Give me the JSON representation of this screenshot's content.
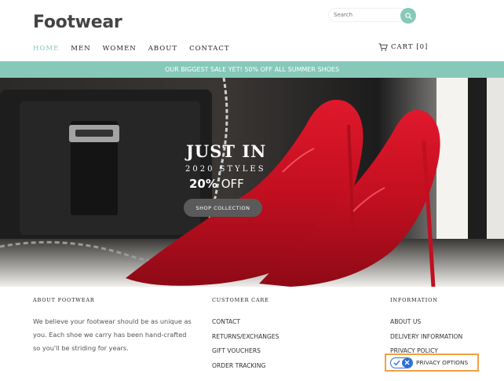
{
  "brand": {
    "name": "Footwear"
  },
  "search": {
    "placeholder": "Search"
  },
  "nav": {
    "items": [
      "HOME",
      "MEN",
      "WOMEN",
      "ABOUT",
      "CONTACT"
    ],
    "active_index": 0
  },
  "cart": {
    "label": "CART [0]"
  },
  "promo_banner": {
    "text": "OUR BIGGEST SALE YET! 50% OFF ALL SUMMER SHOES"
  },
  "hero": {
    "title": "JUST IN",
    "subtitle": "2020 STYLES",
    "offer_bold": "20%",
    "offer_rest": "OFF",
    "button_label": "SHOP COLLECTION"
  },
  "footer": {
    "about": {
      "heading": "ABOUT FOOTWEAR",
      "line1": "We believe your footwear should be as unique as",
      "line2": "you. Each shoe we carry has been hand-crafted",
      "line3": "so you'll be striding for years."
    },
    "customer_care": {
      "heading": "CUSTOMER CARE",
      "links": [
        "CONTACT",
        "RETURNS/EXCHANGES",
        "GIFT VOUCHERS",
        "ORDER TRACKING"
      ]
    },
    "information": {
      "heading": "INFORMATION",
      "links": [
        "ABOUT US",
        "DELIVERY INFORMATION",
        "PRIVACY POLICY"
      ],
      "privacy_options_label": "PRIVACY OPTIONS"
    }
  },
  "colors": {
    "accent": "#86c9b9",
    "highlight_border": "#f0a142",
    "toggle_blue": "#2f6fd6"
  }
}
